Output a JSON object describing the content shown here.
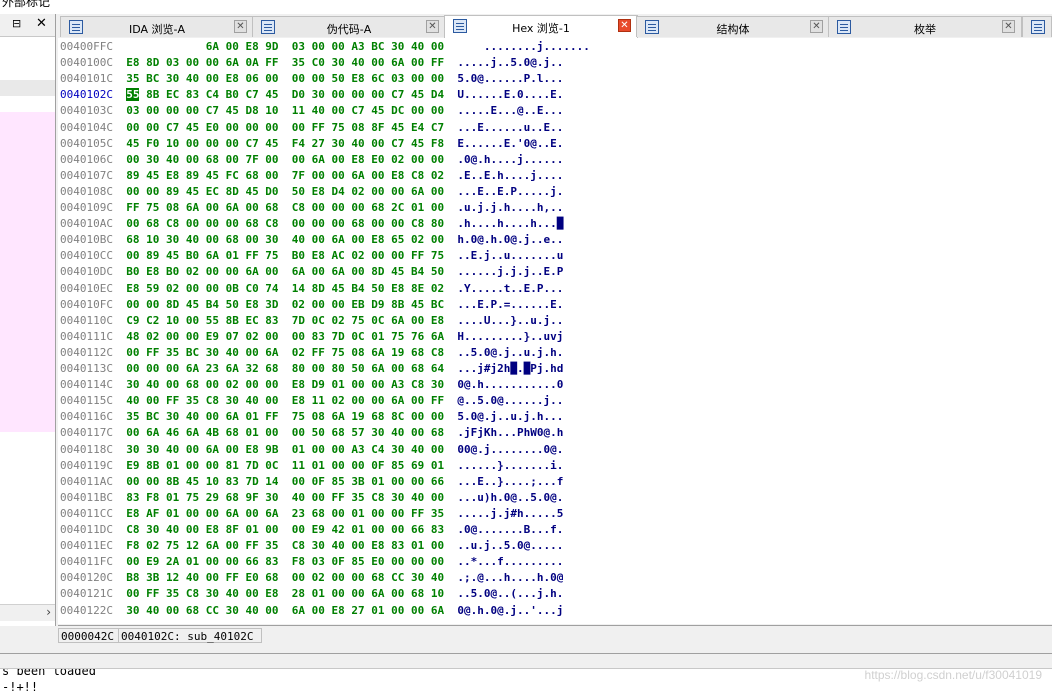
{
  "top_clip_text": "外部标记",
  "left_pane": {
    "pin_label": "⊟",
    "close_label": "✕",
    "scroll_arrow": "›"
  },
  "tabs": [
    {
      "label": "IDA 浏览-A",
      "icon": "ida-view-icon",
      "active": false
    },
    {
      "label": "伪代码-A",
      "icon": "pseudocode-icon",
      "active": false
    },
    {
      "label": "Hex 浏览-1",
      "icon": "hex-view-icon",
      "active": true
    },
    {
      "label": "结构体",
      "icon": "structures-icon",
      "active": false
    },
    {
      "label": "枚举",
      "icon": "enums-icon",
      "active": false
    }
  ],
  "tab_close_glyph": "✕",
  "hex": {
    "current_row_index": 3,
    "rows": [
      {
        "addr": "00400FFC",
        "bytes": "            6A 00 E8 9D  03 00 00 A3 BC 30 40 00",
        "ascii": "    ........j......."
      },
      {
        "addr": "0040100C",
        "bytes": "E8 8D 03 00 00 6A 0A FF  35 C0 30 40 00 6A 00 FF",
        "ascii": ".....j..5.0@.j.."
      },
      {
        "addr": "0040101C",
        "bytes": "35 BC 30 40 00 E8 06 00  00 00 50 E8 6C 03 00 00",
        "ascii": "5.0@......P.l..."
      },
      {
        "addr": "0040102C",
        "bytes": "55 8B EC 83 C4 B0 C7 45  D0 30 00 00 00 C7 45 D4",
        "ascii": "U......E.0....E."
      },
      {
        "addr": "0040103C",
        "bytes": "03 00 00 00 C7 45 D8 10  11 40 00 C7 45 DC 00 00",
        "ascii": ".....E...@..E..."
      },
      {
        "addr": "0040104C",
        "bytes": "00 00 C7 45 E0 00 00 00  00 FF 75 08 8F 45 E4 C7",
        "ascii": "...E......u..E.."
      },
      {
        "addr": "0040105C",
        "bytes": "45 F0 10 00 00 00 C7 45  F4 27 30 40 00 C7 45 F8",
        "ascii": "E......E.'0@..E."
      },
      {
        "addr": "0040106C",
        "bytes": "00 30 40 00 68 00 7F 00  00 6A 00 E8 E0 02 00 00",
        "ascii": ".0@.h....j......"
      },
      {
        "addr": "0040107C",
        "bytes": "89 45 E8 89 45 FC 68 00  7F 00 00 6A 00 E8 C8 02",
        "ascii": ".E..E.h....j...."
      },
      {
        "addr": "0040108C",
        "bytes": "00 00 89 45 EC 8D 45 D0  50 E8 D4 02 00 00 6A 00",
        "ascii": "...E..E.P.....j."
      },
      {
        "addr": "0040109C",
        "bytes": "FF 75 08 6A 00 6A 00 68  C8 00 00 00 68 2C 01 00",
        "ascii": ".u.j.j.h....h,.."
      },
      {
        "addr": "004010AC",
        "bytes": "00 68 C8 00 00 00 68 C8  00 00 00 68 00 00 C8 80",
        "ascii": ".h....h....h...█"
      },
      {
        "addr": "004010BC",
        "bytes": "68 10 30 40 00 68 00 30  40 00 6A 00 E8 65 02 00",
        "ascii": "h.0@.h.0@.j..e.."
      },
      {
        "addr": "004010CC",
        "bytes": "00 89 45 B0 6A 01 FF 75  B0 E8 AC 02 00 00 FF 75",
        "ascii": "..E.j..u.......u"
      },
      {
        "addr": "004010DC",
        "bytes": "B0 E8 B0 02 00 00 6A 00  6A 00 6A 00 8D 45 B4 50",
        "ascii": "......j.j.j..E.P"
      },
      {
        "addr": "004010EC",
        "bytes": "E8 59 02 00 00 0B C0 74  14 8D 45 B4 50 E8 8E 02",
        "ascii": ".Y.....t..E.P..."
      },
      {
        "addr": "004010FC",
        "bytes": "00 00 8D 45 B4 50 E8 3D  02 00 00 EB D9 8B 45 BC",
        "ascii": "...E.P.=......E."
      },
      {
        "addr": "0040110C",
        "bytes": "C9 C2 10 00 55 8B EC 83  7D 0C 02 75 0C 6A 00 E8",
        "ascii": "....U...}..u.j.."
      },
      {
        "addr": "0040111C",
        "bytes": "48 02 00 00 E9 07 02 00  00 83 7D 0C 01 75 76 6A",
        "ascii": "H.........}..uvj"
      },
      {
        "addr": "0040112C",
        "bytes": "00 FF 35 BC 30 40 00 6A  02 FF 75 08 6A 19 68 C8",
        "ascii": "..5.0@.j..u.j.h."
      },
      {
        "addr": "0040113C",
        "bytes": "00 00 00 6A 23 6A 32 68  80 00 80 50 6A 00 68 64",
        "ascii": "...j#j2h█.█Pj.hd"
      },
      {
        "addr": "0040114C",
        "bytes": "30 40 00 68 00 02 00 00  E8 D9 01 00 00 A3 C8 30",
        "ascii": "0@.h...........0"
      },
      {
        "addr": "0040115C",
        "bytes": "40 00 FF 35 C8 30 40 00  E8 11 02 00 00 6A 00 FF",
        "ascii": "@..5.0@......j.."
      },
      {
        "addr": "0040116C",
        "bytes": "35 BC 30 40 00 6A 01 FF  75 08 6A 19 68 8C 00 00",
        "ascii": "5.0@.j..u.j.h..."
      },
      {
        "addr": "0040117C",
        "bytes": "00 6A 46 6A 4B 68 01 00  00 50 68 57 30 40 00 68",
        "ascii": ".jFjKh...PhW0@.h"
      },
      {
        "addr": "0040118C",
        "bytes": "30 30 40 00 6A 00 E8 9B  01 00 00 A3 C4 30 40 00",
        "ascii": "00@.j........0@."
      },
      {
        "addr": "0040119C",
        "bytes": "E9 8B 01 00 00 81 7D 0C  11 01 00 00 0F 85 69 01",
        "ascii": "......}.......i."
      },
      {
        "addr": "004011AC",
        "bytes": "00 00 8B 45 10 83 7D 14  00 0F 85 3B 01 00 00 66",
        "ascii": "...E..}....;...f"
      },
      {
        "addr": "004011BC",
        "bytes": "83 F8 01 75 29 68 9F 30  40 00 FF 35 C8 30 40 00",
        "ascii": "...u)h.0@..5.0@."
      },
      {
        "addr": "004011CC",
        "bytes": "E8 AF 01 00 00 6A 00 6A  23 68 00 01 00 00 FF 35",
        "ascii": ".....j.j#h.....5"
      },
      {
        "addr": "004011DC",
        "bytes": "C8 30 40 00 E8 8F 01 00  00 E9 42 01 00 00 66 83",
        "ascii": ".0@.......B...f."
      },
      {
        "addr": "004011EC",
        "bytes": "F8 02 75 12 6A 00 FF 35  C8 30 40 00 E8 83 01 00",
        "ascii": "..u.j..5.0@....."
      },
      {
        "addr": "004011FC",
        "bytes": "00 E9 2A 01 00 00 66 83  F8 03 0F 85 E0 00 00 00",
        "ascii": "..*...f........."
      },
      {
        "addr": "0040120C",
        "bytes": "B8 3B 12 40 00 FF E0 68  00 02 00 00 68 CC 30 40",
        "ascii": ".;.@...h....h.0@"
      },
      {
        "addr": "0040121C",
        "bytes": "00 FF 35 C8 30 40 00 E8  28 01 00 00 6A 00 68 10",
        "ascii": "..5.0@..(...j.h."
      },
      {
        "addr": "0040122C",
        "bytes": "30 40 00 68 CC 30 40 00  6A 00 E8 27 01 00 00 6A",
        "ascii": "0@.h.0@.j..'...j"
      }
    ]
  },
  "status": {
    "offset": "0000042C",
    "location": "0040102C: sub_40102C"
  },
  "output": {
    "line1": "s been loaded",
    "line2": "-!+!!"
  },
  "watermark": "https://blog.csdn.net/u/f30041019"
}
